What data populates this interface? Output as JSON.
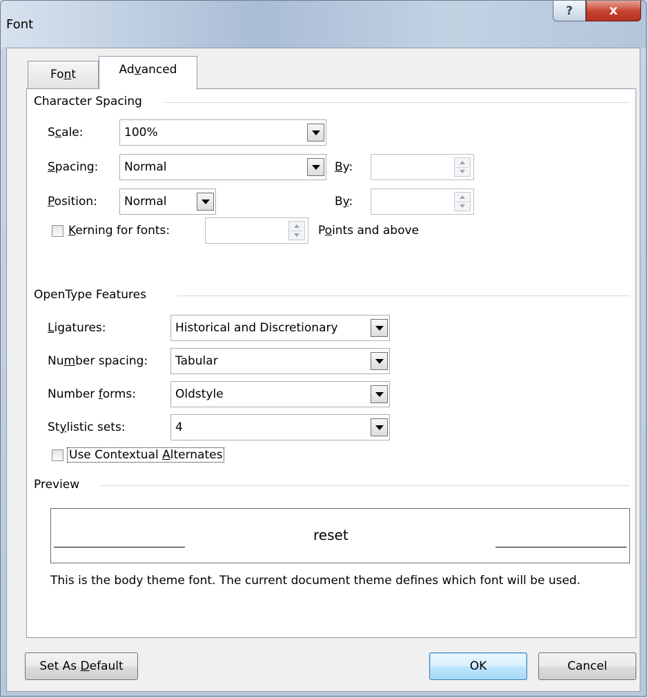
{
  "window": {
    "title": "Font",
    "help_label": "?",
    "close_label": "x"
  },
  "tabs": [
    {
      "label_pre": "Fo",
      "label_key": "n",
      "label_post": "t",
      "selected": false
    },
    {
      "label_pre": "Ad",
      "label_key": "v",
      "label_post": "anced",
      "selected": true
    }
  ],
  "character_spacing": {
    "group_title": "Character Spacing",
    "scale": {
      "label_pre": "S",
      "label_key": "c",
      "label_post": "ale:",
      "value": "100%"
    },
    "spacing": {
      "label_pre": "",
      "label_key": "S",
      "label_post": "pacing:",
      "value": "Normal"
    },
    "spacing_by": {
      "label_pre": "",
      "label_key": "B",
      "label_post": "y:",
      "value": ""
    },
    "position": {
      "label_pre": "",
      "label_key": "P",
      "label_post": "osition:",
      "value": "Normal"
    },
    "position_by": {
      "label_pre": "B",
      "label_key": "y",
      "label_post": ":",
      "value": ""
    },
    "kerning": {
      "label_pre": "",
      "label_key": "K",
      "label_post": "erning for fonts:",
      "checked": false,
      "value": ""
    },
    "kerning_suffix": {
      "label_pre": "P",
      "label_key": "o",
      "label_post": "ints and above"
    }
  },
  "opentype": {
    "group_title": "OpenType Features",
    "ligatures": {
      "label_pre": "",
      "label_key": "L",
      "label_post": "igatures:",
      "value": "Historical and Discretionary"
    },
    "number_spacing": {
      "label_pre": "Nu",
      "label_key": "m",
      "label_post": "ber spacing:",
      "value": "Tabular"
    },
    "number_forms": {
      "label_pre": "Number ",
      "label_key": "f",
      "label_post": "orms:",
      "value": "Oldstyle"
    },
    "stylistic_sets": {
      "label_pre": "St",
      "label_key": "y",
      "label_post": "listic sets:",
      "value": "4"
    },
    "contextual": {
      "label_pre": "Use Contextual ",
      "label_key": "A",
      "label_post": "lternates",
      "checked": false
    }
  },
  "preview": {
    "group_title": "Preview",
    "sample": "reset",
    "description": "This is the body theme font. The current document theme defines which font will be used."
  },
  "buttons": {
    "set_default": {
      "label_pre": "Set As ",
      "label_key": "D",
      "label_post": "efault"
    },
    "ok": "OK",
    "cancel": "Cancel"
  }
}
